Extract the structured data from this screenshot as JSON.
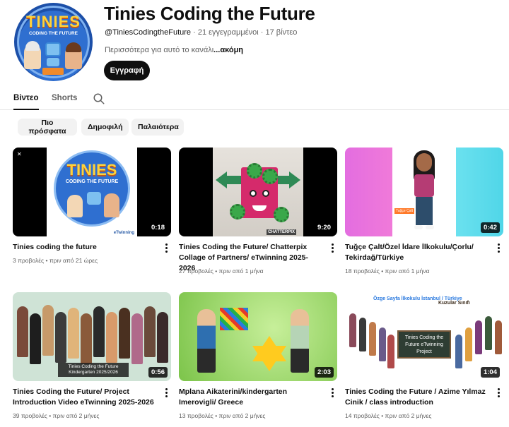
{
  "channel": {
    "name": "Tinies Coding the Future",
    "handle": "@TiniesCodingtheFuture",
    "stats": " · 21 εγγεγραμμένοι · 17 βίντεο",
    "description": "Περισσότερα για αυτό το κανάλι",
    "more": "...ακόμη",
    "subscribe_label": "Εγγραφή",
    "avatar_title": "TINIES",
    "avatar_subtitle": "CODING THE FUTURE"
  },
  "tabs": [
    {
      "label": "Βίντεο",
      "active": true
    },
    {
      "label": "Shorts",
      "active": false
    }
  ],
  "chips": [
    {
      "label": "Πιο πρόσφατα"
    },
    {
      "label": "Δημοφιλή"
    },
    {
      "label": "Παλαιότερα"
    }
  ],
  "videos": [
    {
      "title": "Tinies coding the future",
      "views": "3 προβολές",
      "age": "πριν από 21 ώρες",
      "duration": "0:18"
    },
    {
      "title": "Tinies Coding the Future/ Chatterpix Collage of Partners/ eTwinning 2025-2026",
      "views": "27 προβολές",
      "age": "πριν από 1 μήνα",
      "duration": "9:20"
    },
    {
      "title": "Tuğçe Çalt/Özel İdare İlkokulu/Çorlu/ Tekirdağ/Türkiye",
      "views": "18 προβολές",
      "age": "πριν από 1 μήνα",
      "duration": "0:42"
    },
    {
      "title": "Tinies Coding the Future/ Project Introduction Video eTwinning 2025-2026",
      "views": "39 προβολές",
      "age": "πριν από 2 μήνες",
      "duration": "0:56"
    },
    {
      "title": "Mplana Aikaterini/kindergarten Imerovigli/ Greece",
      "views": "13 προβολές",
      "age": "πριν από 2 μήνες",
      "duration": "2:03"
    },
    {
      "title": "Tinies Coding the Future / Azime Yılmaz Cinik / class introduction",
      "views": "14 προβολές",
      "age": "πριν από 2 μήνες",
      "duration": "1:04"
    }
  ],
  "thumb_text": {
    "t1_title": "TINIES",
    "t1_sub": "CODING THE FUTURE",
    "t1_badge": "eTwinning",
    "t2_badge": "CHATTERPIX",
    "t3_tag": "Tuğçe Çalt",
    "t4_label_1": "Tinies Coding the Future",
    "t4_label_2": "Kindergarten 2025/2026",
    "t6_header": "Özge Sayfa İlkokulu İstanbul / Türkiye",
    "t6_class": "Kuzular Sınıfı",
    "t6_board": "Tinies Coding the Future eTwinning Project"
  },
  "colors": {
    "subscribe_bg": "#0f0f0f",
    "chip_bg": "#f2f2f2",
    "text_secondary": "#606060"
  },
  "icons": {
    "search": "search-icon",
    "menu": "more-vert-icon"
  }
}
